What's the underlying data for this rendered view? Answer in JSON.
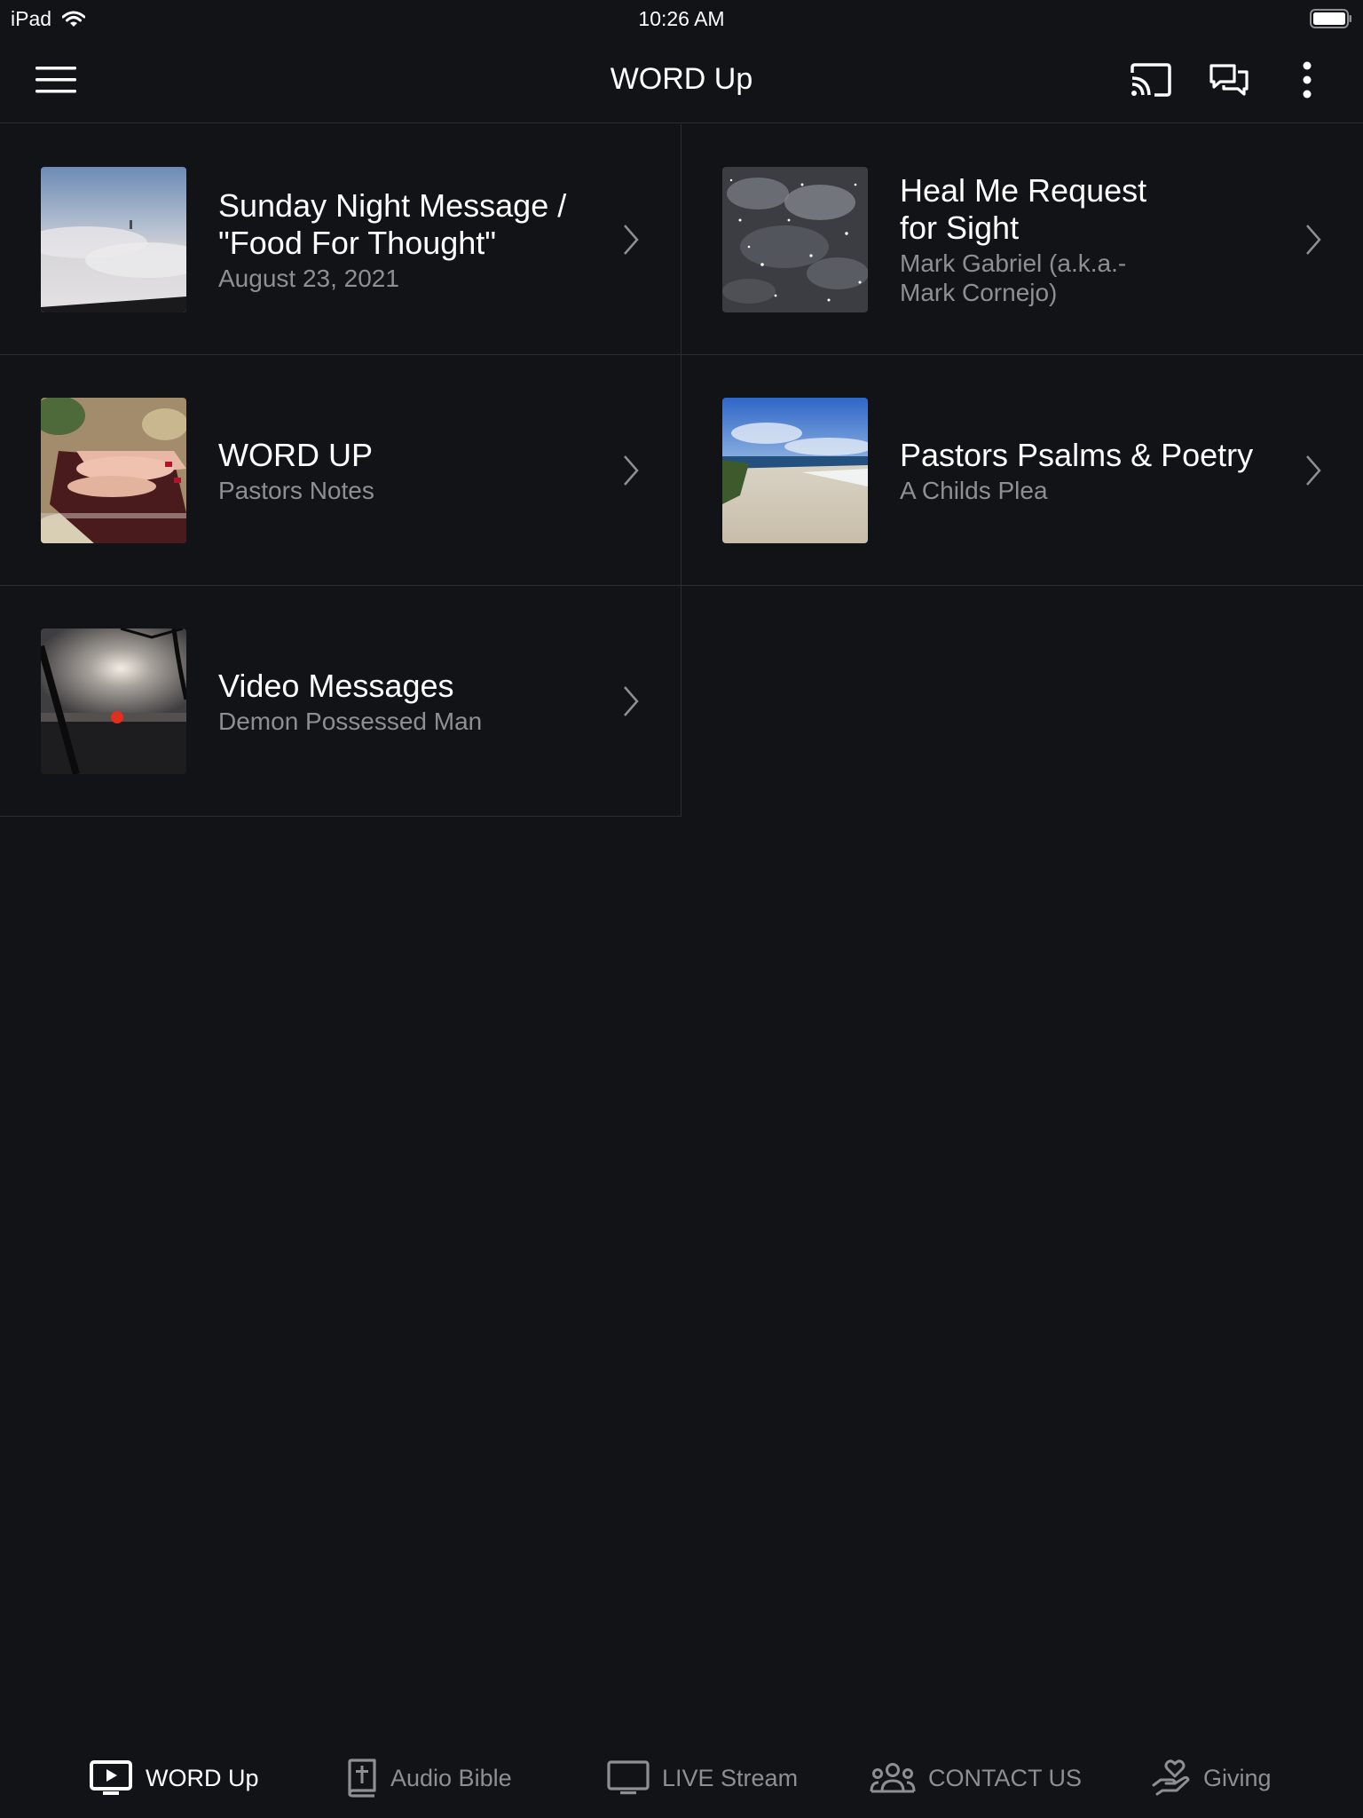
{
  "status_bar": {
    "device": "iPad",
    "time": "10:26 AM"
  },
  "nav": {
    "title": "WORD Up",
    "icons": [
      "menu-icon",
      "cast-icon",
      "chat-icon",
      "more-vertical-icon"
    ]
  },
  "items": [
    {
      "title": "Sunday Night Message / \"Food For Thought\"",
      "subtitle": "August 23, 2021",
      "thumb": "fog-sky"
    },
    {
      "title": "Heal Me Request for Sight",
      "subtitle": "Mark Gabriel (a.k.a.- Mark Cornejo)",
      "thumb": "stars-clouds"
    },
    {
      "title": "WORD UP",
      "subtitle": "Pastors Notes",
      "thumb": "hands-bible"
    },
    {
      "title": "Pastors Psalms & Poetry",
      "subtitle": "A Childs Plea",
      "thumb": "beach"
    },
    {
      "title": "Video Messages",
      "subtitle": "Demon Possessed Man",
      "thumb": "sunset"
    }
  ],
  "tabs": [
    {
      "label": "WORD Up",
      "icon": "tv-play-icon",
      "active": true
    },
    {
      "label": "Audio Bible",
      "icon": "bible-icon",
      "active": false
    },
    {
      "label": "LIVE Stream",
      "icon": "monitor-icon",
      "active": false
    },
    {
      "label": "CONTACT US",
      "icon": "group-icon",
      "active": false
    },
    {
      "label": "Giving",
      "icon": "hand-heart-icon",
      "active": false
    }
  ],
  "colors": {
    "background": "#121316",
    "divider": "#2c2d31",
    "secondary_text": "#8e8f93",
    "primary_text": "#ffffff"
  }
}
